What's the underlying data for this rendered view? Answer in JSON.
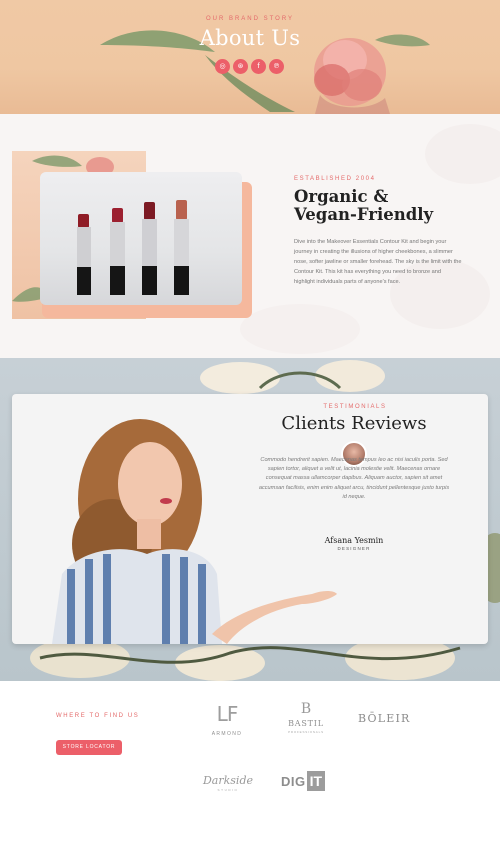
{
  "hero": {
    "eyebrow": "OUR BRAND STORY",
    "title": "About Us",
    "socials": [
      {
        "icon": "instagram-icon",
        "glyph": "◎"
      },
      {
        "icon": "dribbble-icon",
        "glyph": "⊛"
      },
      {
        "icon": "facebook-icon",
        "glyph": "f"
      },
      {
        "icon": "pinterest-icon",
        "glyph": "℗"
      }
    ]
  },
  "about": {
    "eyebrow": "ESTABLISHED 2004",
    "title_line1": "Organic &",
    "title_line2": "Vegan-Friendly",
    "body": "Dive into the Makeover Essentials Contour Kit and begin your journey in creating the illusions of higher cheekbones, a slimmer nose, softer jawline or smaller forehead. The sky is the limit with the Contour Kit. This kit has everything you need to bronze and highlight individuals parts of anyone's face."
  },
  "reviews": {
    "eyebrow": "TESTIMONIALS",
    "title": "Clients Reviews",
    "quote": "Commodo hendrerit sapien. Maecenas tempus leo ac nisi iaculis porta. Sed sapien tortor, aliquet a velit ut, lacinia molestie velit. Maecenas ornare consequat massa ullamcorper dapibus. Aliquam auctor, sapien sit amet accumsan facilisis, enim enim aliquet arcu, tincidunt pellentesque justo turpis id neque.",
    "name": "Afsana Yesmin",
    "role": "DESIGNER"
  },
  "brands": {
    "eyebrow": "WHERE TO FIND US",
    "store_button": "STORE LOCATOR",
    "logos": {
      "armond_mark": "LF",
      "armond_text": "ARMOND",
      "bastil_mark": "B",
      "bastil_text": "BASTIL",
      "bastil_sub": "PROFESSIONALS",
      "boleir": "BŌLEIR",
      "darkside": "Darkside",
      "darkside_sub": "STUDIO",
      "digit_left": "DIG",
      "digit_right": "IT"
    }
  },
  "colors": {
    "accent": "#ec5f69",
    "eyebrow": "#e46a6a",
    "hero_bg": "#efc7a2",
    "reviews_bg": "#c1cbd1"
  }
}
